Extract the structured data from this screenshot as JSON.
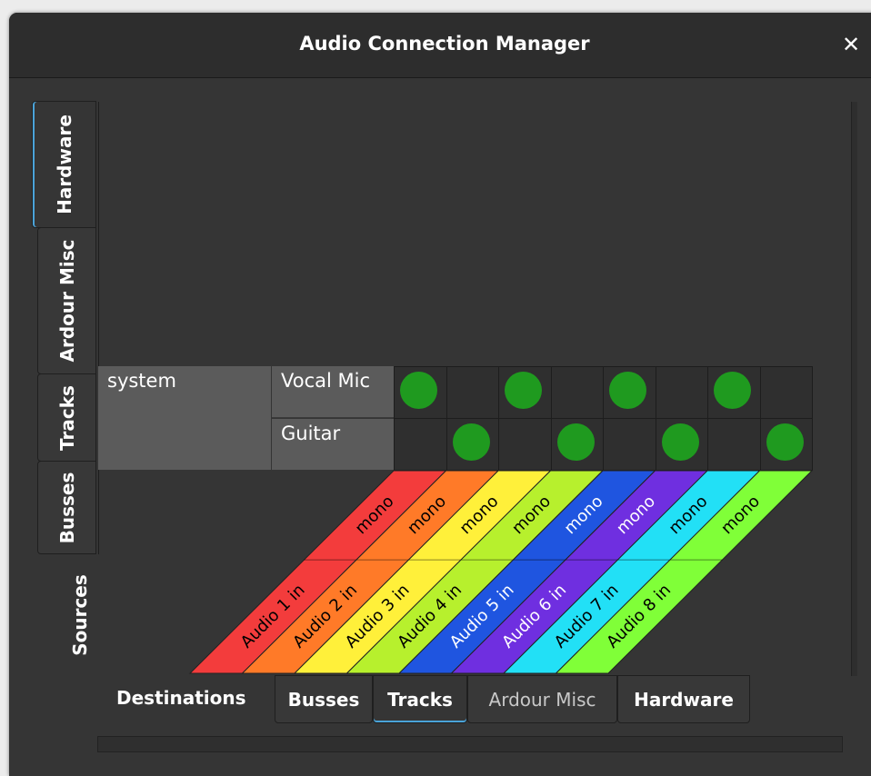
{
  "window": {
    "title": "Audio Connection Manager"
  },
  "sources": {
    "label": "Sources",
    "tabs": [
      {
        "label": "Hardware",
        "active": true
      },
      {
        "label": "Ardour Misc",
        "active": false
      },
      {
        "label": "Tracks",
        "active": false
      },
      {
        "label": "Busses",
        "active": false
      }
    ]
  },
  "destinations": {
    "label": "Destinations",
    "tabs": [
      {
        "label": "Busses",
        "active": false
      },
      {
        "label": "Tracks",
        "active": true
      },
      {
        "label": "Ardour Misc",
        "active": false
      },
      {
        "label": "Hardware",
        "active": false
      }
    ]
  },
  "matrix": {
    "source_group": "system",
    "source_ports": [
      "Vocal Mic",
      "Guitar"
    ],
    "destinations": [
      {
        "name": "Audio 1 in",
        "channel": "mono",
        "color": "#f33c3c"
      },
      {
        "name": "Audio 2 in",
        "channel": "mono",
        "color": "#ff7a28"
      },
      {
        "name": "Audio 3 in",
        "channel": "mono",
        "color": "#fff03a"
      },
      {
        "name": "Audio 4 in",
        "channel": "mono",
        "color": "#b7f02d"
      },
      {
        "name": "Audio 5 in",
        "channel": "mono",
        "color": "#1f55e0"
      },
      {
        "name": "Audio 6 in",
        "channel": "mono",
        "color": "#6f2fe0"
      },
      {
        "name": "Audio 7 in",
        "channel": "mono",
        "color": "#22e0f6"
      },
      {
        "name": "Audio 8 in",
        "channel": "mono",
        "color": "#80ff38"
      }
    ],
    "connections": [
      [
        true,
        false,
        true,
        false,
        true,
        false,
        true,
        false
      ],
      [
        false,
        true,
        false,
        true,
        false,
        true,
        false,
        true
      ]
    ],
    "connected_color": "#1f9a1f"
  }
}
